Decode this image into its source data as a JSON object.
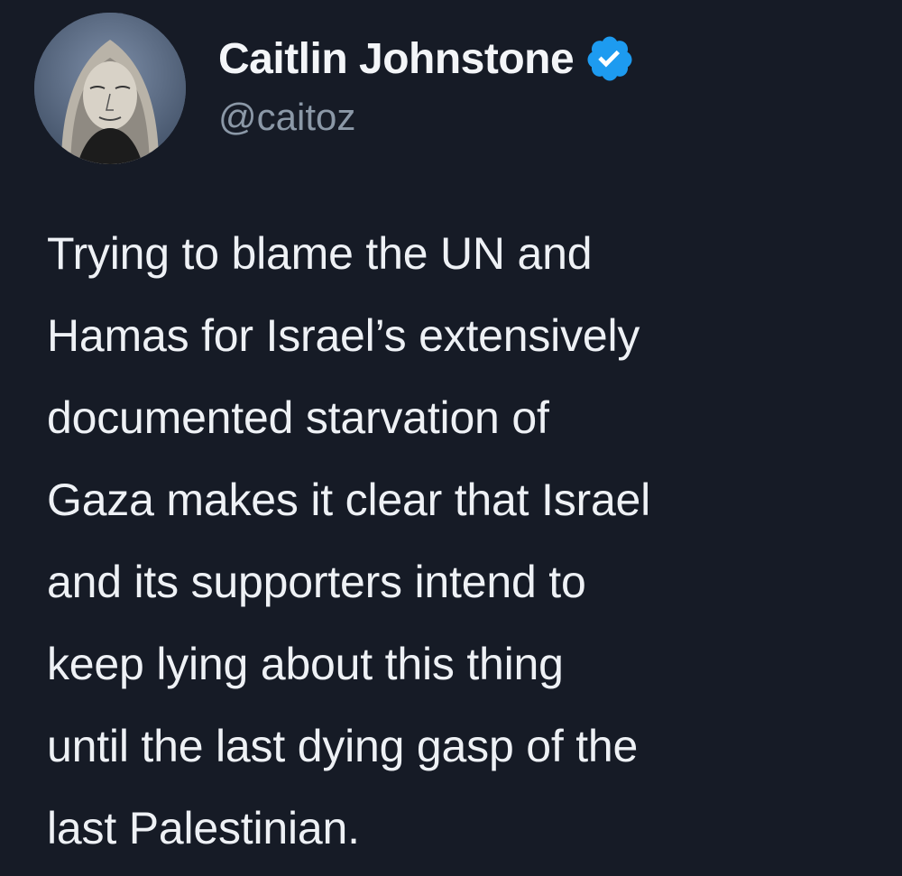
{
  "tweet": {
    "author": {
      "display_name": "Caitlin Johnstone",
      "handle": "@caitoz",
      "verified": true,
      "verified_icon": "verified-badge-icon",
      "avatar": "profile-photo"
    },
    "text": "Trying to blame the UN and\nHamas for Israel’s extensively\ndocumented starvation of\nGaza makes it clear that Israel\nand its supporters intend to\nkeep lying about this thing\nuntil the last dying gasp of the\nlast Palestinian."
  },
  "colors": {
    "background": "#161b26",
    "text": "#eef1f5",
    "handle": "#8b98a7",
    "verified_blue": "#1d9bf0"
  }
}
